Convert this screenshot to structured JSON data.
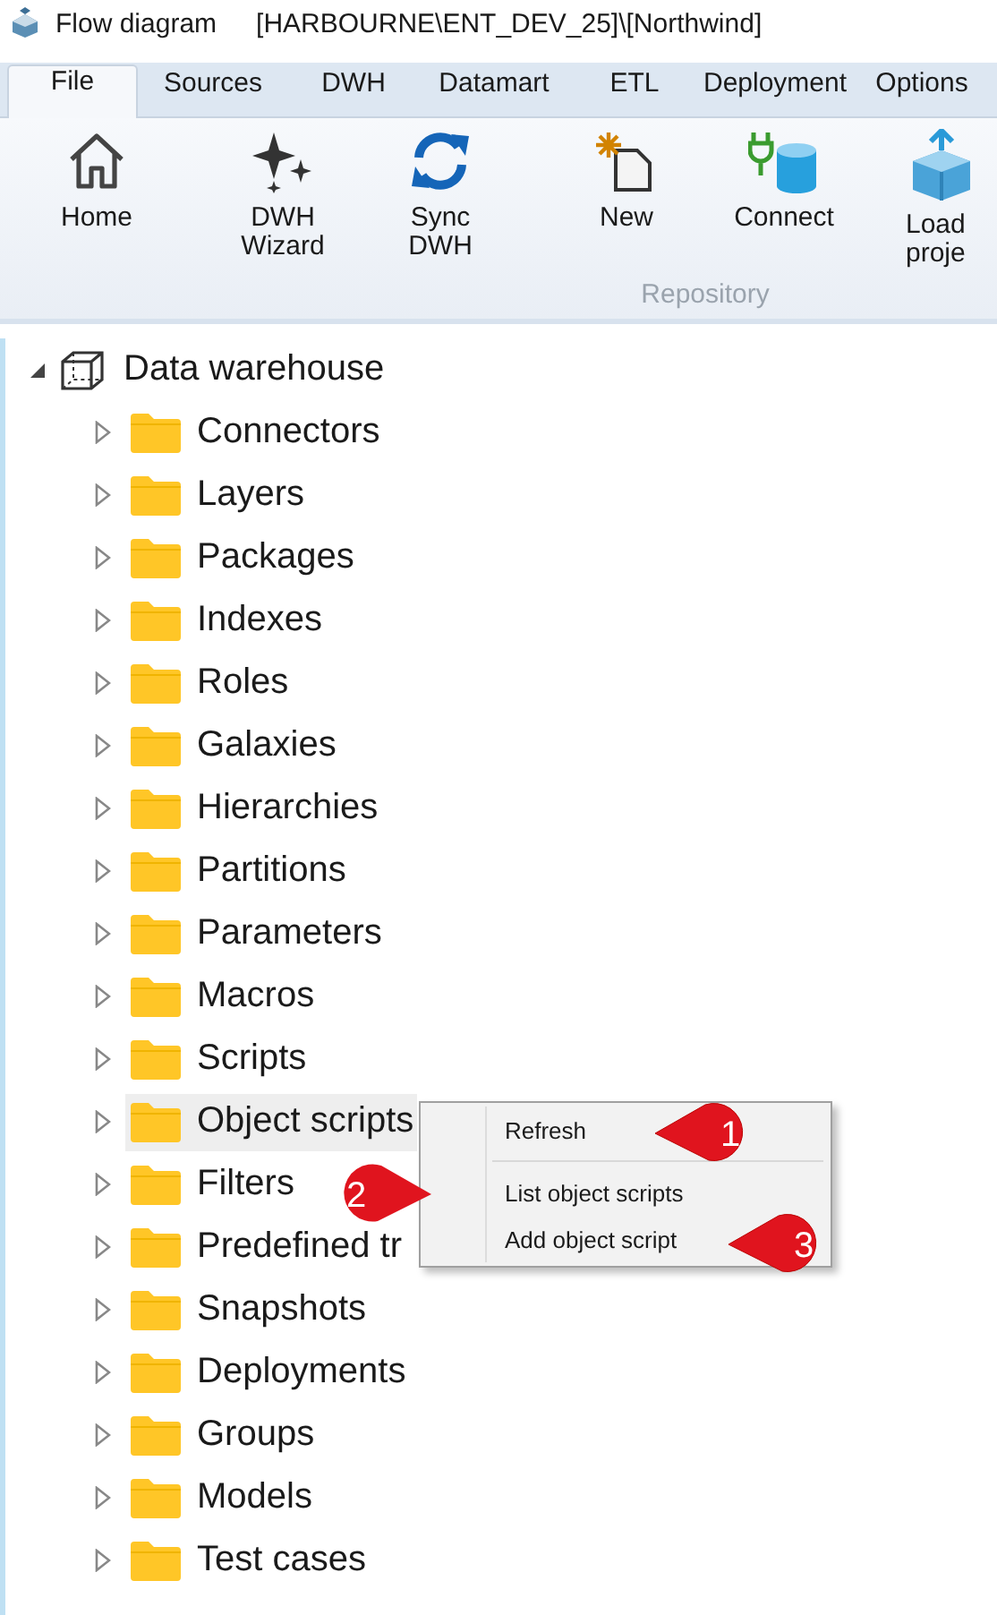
{
  "window": {
    "title": "Flow diagram",
    "path": "[HARBOURNE\\ENT_DEV_25]\\[Northwind]"
  },
  "tabs": [
    {
      "label": "File",
      "selected": true
    },
    {
      "label": "Sources",
      "selected": false
    },
    {
      "label": "DWH",
      "selected": false
    },
    {
      "label": "Datamart",
      "selected": false
    },
    {
      "label": "ETL",
      "selected": false
    },
    {
      "label": "Deployment",
      "selected": false
    },
    {
      "label": "Options",
      "selected": false
    }
  ],
  "ribbon": {
    "groups": [
      {
        "buttons": [
          {
            "kind": "home",
            "label": "Home"
          }
        ]
      },
      {
        "buttons": [
          {
            "kind": "wizard",
            "label": "DWH\nWizard"
          },
          {
            "kind": "sync",
            "label": "Sync\nDWH"
          }
        ]
      },
      {
        "label": "Repository",
        "buttons": [
          {
            "kind": "new",
            "label": "New"
          },
          {
            "kind": "connect",
            "label": "Connect"
          }
        ]
      },
      {
        "buttons": [
          {
            "kind": "load",
            "label": "Load\nproje"
          }
        ]
      }
    ]
  },
  "tree": {
    "label": "Data warehouse",
    "expanded": true,
    "children": [
      {
        "label": "Connectors",
        "expanded": false,
        "selected": false
      },
      {
        "label": "Layers",
        "expanded": false,
        "selected": false
      },
      {
        "label": "Packages",
        "expanded": false,
        "selected": false
      },
      {
        "label": "Indexes",
        "expanded": false,
        "selected": false
      },
      {
        "label": "Roles",
        "expanded": false,
        "selected": false
      },
      {
        "label": "Galaxies",
        "expanded": false,
        "selected": false
      },
      {
        "label": "Hierarchies",
        "expanded": false,
        "selected": false
      },
      {
        "label": "Partitions",
        "expanded": false,
        "selected": false
      },
      {
        "label": "Parameters",
        "expanded": false,
        "selected": false
      },
      {
        "label": "Macros",
        "expanded": false,
        "selected": false
      },
      {
        "label": "Scripts",
        "expanded": false,
        "selected": false
      },
      {
        "label": "Object scripts",
        "expanded": false,
        "selected": true
      },
      {
        "label": "Filters",
        "expanded": false,
        "selected": false
      },
      {
        "label": "Predefined tr",
        "expanded": false,
        "selected": false
      },
      {
        "label": "Snapshots",
        "expanded": false,
        "selected": false
      },
      {
        "label": "Deployments",
        "expanded": false,
        "selected": false
      },
      {
        "label": "Groups",
        "expanded": false,
        "selected": false
      },
      {
        "label": "Models",
        "expanded": false,
        "selected": false
      },
      {
        "label": "Test cases",
        "expanded": false,
        "selected": false
      }
    ]
  },
  "context_menu": {
    "items": [
      {
        "kind": "item",
        "label": "Refresh"
      },
      {
        "kind": "separator"
      },
      {
        "kind": "item",
        "label": "List object scripts"
      },
      {
        "kind": "item",
        "label": "Add object script"
      }
    ]
  },
  "callouts": [
    {
      "number": "1"
    },
    {
      "number": "2"
    },
    {
      "number": "3"
    }
  ]
}
